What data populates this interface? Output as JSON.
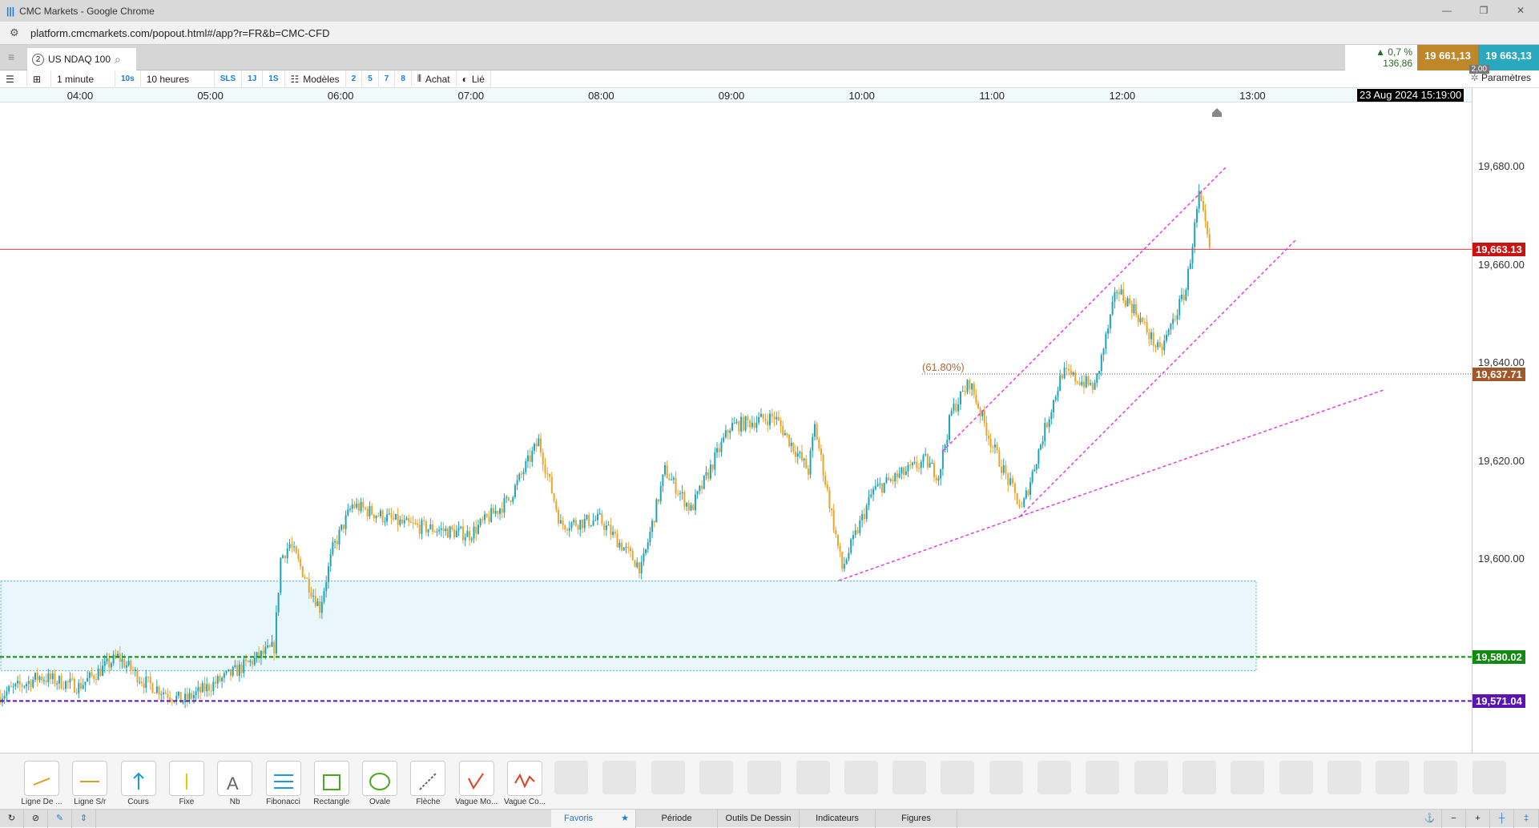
{
  "browser": {
    "title": "CMC Markets - Google Chrome",
    "url": "platform.cmcmarkets.com/popout.html#/app?r=FR&b=CMC-CFD"
  },
  "tab": {
    "number": "2",
    "instrument": "US NDAQ 100"
  },
  "quote": {
    "change_pct": "▲ 0,7 %",
    "change_pts": "136,86",
    "sell": "19 661,13",
    "buy": "19 663,13",
    "spread": "2,00"
  },
  "toolbar": {
    "interval": "1 minute",
    "interval_short": "10s",
    "range": "10 heures",
    "range_btns": [
      "SLS",
      "1J",
      "1S"
    ],
    "templates": "Modèles",
    "nums": [
      "2",
      "5",
      "7",
      "8"
    ],
    "chart_type": "Achat",
    "linked": "Lié",
    "settings": "Paramètres"
  },
  "time_axis": {
    "labels": [
      "04:00",
      "05:00",
      "06:00",
      "07:00",
      "08:00",
      "09:00",
      "10:00",
      "11:00",
      "12:00",
      "13:00"
    ],
    "cursor_date": "23 Aug 2024 15:19:00"
  },
  "price_axis": {
    "labels": [
      "19,680.00",
      "19,660.00",
      "19,640.00",
      "19,620.00",
      "19,600.00"
    ]
  },
  "levels": [
    {
      "label": "19,663.13",
      "value": 19663.13,
      "color": "#cc1111"
    },
    {
      "label": "19,637.71",
      "value": 19637.71,
      "color": "#a0582a"
    },
    {
      "label": "19,580.02",
      "value": 19580.02,
      "color": "#118a11"
    },
    {
      "label": "19,571.04",
      "value": 19571.04,
      "color": "#5a14b4"
    }
  ],
  "fib_label": "(61.80%)",
  "colors": {
    "up": "#1fa3b5",
    "down": "#eba42a",
    "trend": "#e040e0"
  },
  "chart_data": {
    "type": "candlestick",
    "x_unit": "hour",
    "path": [
      [
        3.38,
        19572
      ],
      [
        3.7,
        19576
      ],
      [
        4.0,
        19574
      ],
      [
        4.3,
        19580
      ],
      [
        4.5,
        19575
      ],
      [
        4.8,
        19571
      ],
      [
        5.2,
        19577
      ],
      [
        5.5,
        19582
      ],
      [
        5.55,
        19600
      ],
      [
        5.62,
        19603
      ],
      [
        5.85,
        19590
      ],
      [
        5.95,
        19602
      ],
      [
        6.1,
        19611
      ],
      [
        6.5,
        19607
      ],
      [
        7.0,
        19605
      ],
      [
        7.3,
        19612
      ],
      [
        7.53,
        19624
      ],
      [
        7.7,
        19607
      ],
      [
        8.0,
        19608
      ],
      [
        8.32,
        19598
      ],
      [
        8.5,
        19618
      ],
      [
        8.7,
        19610
      ],
      [
        9.0,
        19627
      ],
      [
        9.34,
        19629
      ],
      [
        9.6,
        19618
      ],
      [
        9.65,
        19627
      ],
      [
        9.86,
        19598
      ],
      [
        10.1,
        19614
      ],
      [
        10.5,
        19620
      ],
      [
        10.6,
        19617
      ],
      [
        10.7,
        19630
      ],
      [
        10.84,
        19636
      ],
      [
        11.0,
        19624
      ],
      [
        11.1,
        19618
      ],
      [
        11.24,
        19610
      ],
      [
        11.4,
        19625
      ],
      [
        11.55,
        19638
      ],
      [
        11.8,
        19635
      ],
      [
        11.97,
        19655
      ],
      [
        12.1,
        19651
      ],
      [
        12.3,
        19642
      ],
      [
        12.5,
        19655
      ],
      [
        12.6,
        19674
      ],
      [
        12.68,
        19663
      ]
    ],
    "ylim": [
      19565,
      19695
    ]
  },
  "drawing_tools": [
    "Ligne De ...",
    "Ligne S/r",
    "Cours",
    "Fixe",
    "Nb",
    "Fibonacci",
    "Rectangle",
    "Ovale",
    "Flèche",
    "Vague Mo...",
    "Vague Co..."
  ],
  "bottom_tabs": [
    "Favoris",
    "Période",
    "Outils De Dessin",
    "Indicateurs",
    "Figures"
  ]
}
